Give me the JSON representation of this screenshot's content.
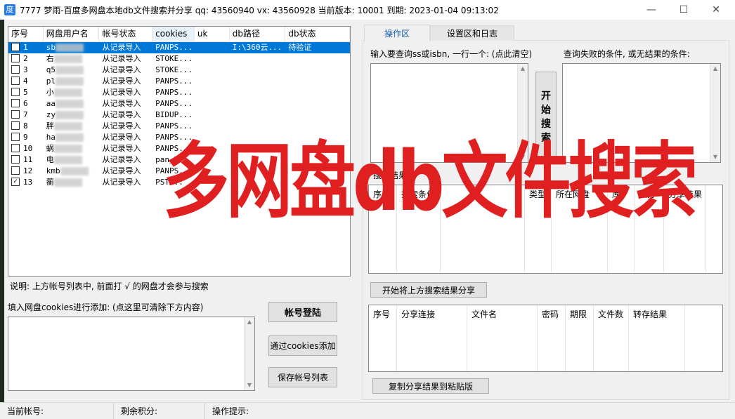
{
  "window": {
    "title": "7777  梦雨-百度多网盘本地db文件搜索并分享   qq: 43560940  vx: 43560928  当前版本: 10001  到期: 2023-01-04 09:13:02",
    "app_icon": "度",
    "min_glyph": "—",
    "max_glyph": "☐",
    "close_glyph": "✕"
  },
  "accounts": {
    "columns": [
      "序号",
      "网盘用户名",
      "帐号状态",
      "cookies",
      "uk",
      "db路径",
      "db状态"
    ],
    "rows": [
      {
        "seq": "1",
        "user": "sb",
        "status": "从记录导入",
        "cookies": "PANPS...",
        "uk": "",
        "path": "I:\\360云...",
        "dbstat": "待验证",
        "checked": false
      },
      {
        "seq": "2",
        "user": "右",
        "status": "从记录导入",
        "cookies": "STOKE...",
        "uk": "",
        "path": "",
        "dbstat": "",
        "checked": false
      },
      {
        "seq": "3",
        "user": "q5",
        "status": "从记录导入",
        "cookies": "STOKE...",
        "uk": "",
        "path": "",
        "dbstat": "",
        "checked": false
      },
      {
        "seq": "4",
        "user": "pl",
        "status": "从记录导入",
        "cookies": "PANPS...",
        "uk": "",
        "path": "",
        "dbstat": "",
        "checked": false
      },
      {
        "seq": "5",
        "user": "小",
        "status": "从记录导入",
        "cookies": "PANPS...",
        "uk": "",
        "path": "",
        "dbstat": "",
        "checked": false
      },
      {
        "seq": "6",
        "user": "aa",
        "status": "从记录导入",
        "cookies": "PANPS...",
        "uk": "",
        "path": "",
        "dbstat": "",
        "checked": false
      },
      {
        "seq": "7",
        "user": "zy",
        "status": "从记录导入",
        "cookies": "BIDUP...",
        "uk": "",
        "path": "",
        "dbstat": "",
        "checked": false
      },
      {
        "seq": "8",
        "user": "胖",
        "status": "从记录导入",
        "cookies": "PANPS...",
        "uk": "",
        "path": "",
        "dbstat": "",
        "checked": false
      },
      {
        "seq": "9",
        "user": "ha",
        "status": "从记录导入",
        "cookies": "PANPS...",
        "uk": "",
        "path": "",
        "dbstat": "",
        "checked": false
      },
      {
        "seq": "10",
        "user": "蜗",
        "status": "从记录导入",
        "cookies": "PANPS...",
        "uk": "",
        "path": "",
        "dbstat": "",
        "checked": false
      },
      {
        "seq": "11",
        "user": "电",
        "status": "从记录导入",
        "cookies": "pan_l...",
        "uk": "",
        "path": "",
        "dbstat": "",
        "checked": false
      },
      {
        "seq": "12",
        "user": "kmb",
        "status": "从记录导入",
        "cookies": "PANPS...",
        "uk": "",
        "path": "",
        "dbstat": "",
        "checked": false
      },
      {
        "seq": "13",
        "user": "蘅",
        "status": "从记录导入",
        "cookies": "PST...",
        "uk": "",
        "path": "",
        "dbstat": "",
        "checked": true
      }
    ]
  },
  "left": {
    "note": "说明: 上方帐号列表中, 前面打 √ 的网盘才会参与搜索",
    "cookie_label": "填入网盘cookies进行添加: (点这里可清除下方内容)",
    "login_button": "帐号登陆",
    "add_cookie_button": "通过cookies添加",
    "save_button": "保存帐号列表"
  },
  "tabs": {
    "operation": "操作区",
    "settings": "设置区和日志"
  },
  "operation": {
    "query_label": "输入要查询ss或isbn, 一行一个: (点此清空)",
    "fail_label": "查询失败的条件, 或无结果的条件:",
    "start_button_chars": [
      "开",
      "始",
      "搜",
      "索"
    ],
    "results_label": "搜索结果",
    "results_columns": [
      "序号",
      "搜索条件",
      "类型",
      "所在网盘",
      "库",
      "积分",
      "分享结果"
    ],
    "share_button": "开始将上方搜索结果分享",
    "share_columns": [
      "序号",
      "分享连接",
      "文件名",
      "密码",
      "期限",
      "文件数",
      "转存结果"
    ],
    "copy_button": "复制分享结果到粘贴版"
  },
  "status": {
    "current_account": "当前帐号:",
    "remaining_points": "剩余积分:",
    "op_hint": "操作提示:"
  },
  "overlay": {
    "text": "多网盘db文件搜索",
    "color": "#e02020"
  },
  "colors": {
    "selection": "#0078d7",
    "tab_active_text": "#1a5eaf"
  }
}
